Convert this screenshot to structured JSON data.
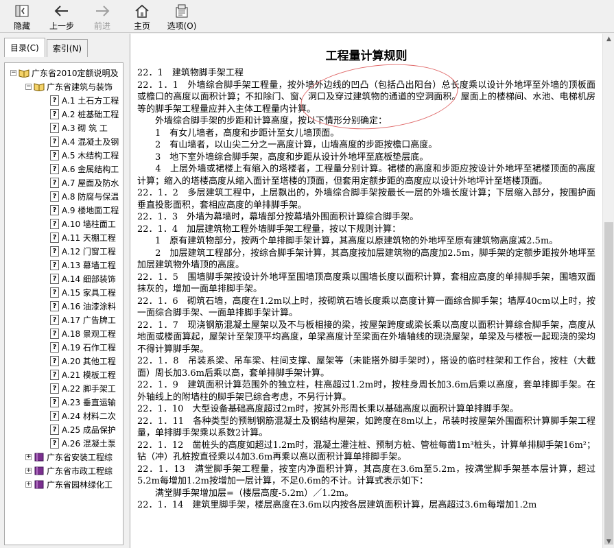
{
  "toolbar": {
    "hide": "隐藏",
    "back": "上一步",
    "forward": "前进",
    "home": "主页",
    "options": "选项(O)"
  },
  "nav": {
    "tabs": [
      {
        "label": "目录(C)"
      },
      {
        "label": "索引(N)"
      }
    ],
    "tree": [
      {
        "label": "广东省2010定额说明及"
      },
      {
        "label": "广东省建筑与装饰"
      },
      {
        "label": "A.1  土石方工程"
      },
      {
        "label": "A.2  桩基础工程"
      },
      {
        "label": "A.3  砌 筑 工"
      },
      {
        "label": "A.4  混凝土及钢"
      },
      {
        "label": "A.5  木结构工程"
      },
      {
        "label": "A.6  金属结构工"
      },
      {
        "label": "A.7  屋面及防水"
      },
      {
        "label": "A.8  防腐与保温"
      },
      {
        "label": "A.9  楼地面工程"
      },
      {
        "label": "A.10  墙柱面工"
      },
      {
        "label": "A.11  天棚工程"
      },
      {
        "label": "A.12  门窗工程"
      },
      {
        "label": "A.13  幕墙工程"
      },
      {
        "label": "A.14  细部装饰"
      },
      {
        "label": "A.15  家具工程"
      },
      {
        "label": "A.16  油漆涂料"
      },
      {
        "label": "A.17  广告牌工"
      },
      {
        "label": "A.18  景观工程"
      },
      {
        "label": "A.19  石作工程"
      },
      {
        "label": "A.20  其他工程"
      },
      {
        "label": "A.21  模板工程"
      },
      {
        "label": "A.22  脚手架工"
      },
      {
        "label": "A.23  垂直运输"
      },
      {
        "label": "A.24  材料二次"
      },
      {
        "label": "A.25  成品保护"
      },
      {
        "label": "A.26  混凝土泵"
      },
      {
        "label": "广东省安装工程综"
      },
      {
        "label": "广东省市政工程综"
      },
      {
        "label": "广东省园林绿化工"
      }
    ]
  },
  "doc": {
    "title": "工程量计算规则",
    "paragraphs": [
      "22．1　建筑物脚手架工程",
      "22．1．1　外墙综合脚手架工程量，按外墙外边线的凹凸（包括凸出阳台）总长度乘以设计外地坪至外墙的顶板面或檐口的高度以面积计算；不扣除门、窗、洞口及穿过建筑物的通道的空洞面积。屋面上的楼梯间、水池、电梯机房等的脚手架工程量应并入主体工程量内计算。",
      "　　外墙综合脚手架的步距和计算高度，按以下情形分别确定：",
      "　　1　有女儿墙者，高度和步距计至女儿墙顶面。",
      "　　2　有山墙者，以山尖二分之一高度计算，山墙高度的步距按檐口高度。",
      "　　3　地下室外墙综合脚手架，高度和步距从设计外地坪至底板垫层底。",
      "　　4　上层外墙或裙楼上有缩入的塔楼者，工程量分别计算。裙楼的高度和步距应按设计外地坪至裙楼顶面的高度计算；缩入的塔楼高度从缩入面计至塔楼的顶面，但套用定额步距的高度应以设计外地坪计至塔楼顶面。",
      "22．1．2　多层建筑工程中，上层飘出的，外墙综合脚手架按最长一层的外墙长度计算；下层缩入部分，按围护面垂直投影面积，套相应高度的单排脚手架。",
      "22．1．3　外墙为幕墙时，幕墙部分按幕墙外围面积计算综合脚手架。",
      "22．1．4　加层建筑物工程外墙脚手架工程量，按以下规则计算：",
      "　　1　原有建筑物部分，按两个单排脚手架计算，其高度以原建筑物的外地坪至原有建筑物高度减2.5m。",
      "　　2　加层建筑工程部分，按综合脚手架计算，其高度按加层建筑物的高度加2.5m，脚手架的定额步距按外地坪至加层建筑物外墙顶的高度。",
      "22．1．5　围墙脚手架按设计外地坪至围墙顶高度乘以围墙长度以面积计算，套相应高度的单排脚手架，围墙双面抹灰的，增加一面单排脚手架。",
      "22．1．6　砌筑石墙，高度在1.2m以上时，按砌筑石墙长度乘以高度计算一面综合脚手架；墙厚40cm以上时，按一面综合脚手架、一面单排脚手架计算。",
      "22．1．7　现浇钢筋混凝土屋架以及不与板相接的梁，按屋架跨度或梁长乘以高度以面积计算综合脚手架，高度从地面或楼面算起，屋架计至架顶平均高度，单梁高度计至梁面在外墙轴线的现浇屋架，单梁及与楼板一起现浇的梁均不得计算脚手架。",
      "22．1．8　吊装系梁、吊车梁、柱间支撑、屋架等（未能搭外脚手架时），搭设的临时柱架和工作台，按柱（大截面）周长加3.6m后乘以高，套单排脚手架计算。",
      "22．1．9　建筑面积计算范围外的独立柱，柱高超过1.2m时，按柱身周长加3.6m后乘以高度，套单排脚手架。在外轴线上的附墙柱的脚手架已综合考虑，不另行计算。",
      "22．1．10　大型设备基础高度超过2m时，按其外形周长乘以基础高度以面积计算单排脚手架。",
      "22．1．11　各种类型的预制钢筋混凝土及钢结构屋架，如跨度在8m以上，吊装时按屋架外围面积计算脚手架工程量，单排脚手架乘以系数2计算。",
      "22．1．12　凿桩头的高度如超过1.2m时，混凝土灌注桩、预制方桩、管桩每凿1m³桩头，计算单排脚手架16m²；钻（冲）孔桩按直径乘以4加3.6m再乘以高以面积计算单排脚手架。",
      "22．1．13　满堂脚手架工程量，按室内净面积计算，其高度在3.6m至5.2m，按满堂脚手架基本层计算，超过5.2m每增加1.2m按增加一层计算，不足0.6m的不计。计算式表示如下：",
      "　　满堂脚手架增加层=（楼层高度-5.2m）／1.2m。",
      "22．1．14　建筑里脚手架，楼层高度在3.6m以内按各层建筑面积计算，层高超过3.6m每增加1.2m"
    ]
  }
}
